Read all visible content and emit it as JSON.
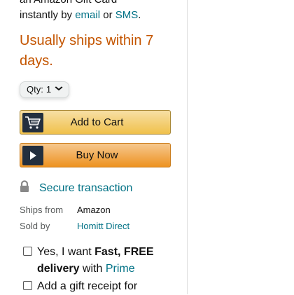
{
  "delivery": {
    "line1": "an Amazon Gift Card",
    "line2_prefix": "instantly by ",
    "email_link": "email",
    "or_text": " or ",
    "sms_link": "SMS",
    "period": "."
  },
  "shipping_notice": "Usually ships within 7 days.",
  "quantity": {
    "label": "Qty:",
    "value": "1"
  },
  "buttons": {
    "add_to_cart": "Add to Cart",
    "buy_now": "Buy Now"
  },
  "secure_transaction": "Secure transaction",
  "seller_info": {
    "ships_from_label": "Ships from",
    "ships_from_value": "Amazon",
    "sold_by_label": "Sold by",
    "sold_by_value": "Homitt Direct"
  },
  "options": {
    "fast_delivery": {
      "prefix": "Yes, I want ",
      "bold": "Fast, FREE delivery",
      "middle": " with ",
      "prime_link": "Prime"
    },
    "gift_receipt": "Add a gift receipt for"
  },
  "colors": {
    "ship_notice": "#C45500",
    "link": "#007185",
    "cart_button": "#f0c14b",
    "buy_button": "#ed9220",
    "icon_box": "#232f3e"
  },
  "icons": [
    "cart-icon",
    "play-icon",
    "lock-icon",
    "chevron-down-icon"
  ]
}
